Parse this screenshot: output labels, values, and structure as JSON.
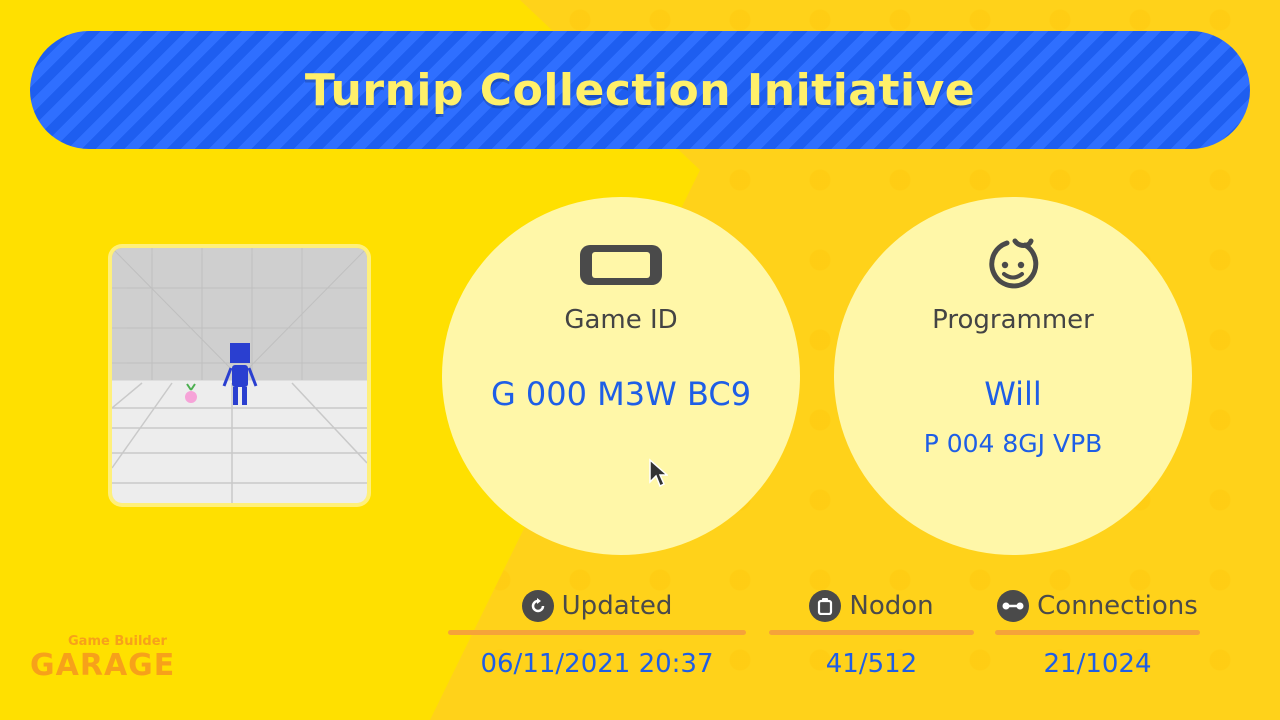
{
  "header": {
    "title": "Turnip Collection Initiative"
  },
  "game": {
    "label": "Game ID",
    "value": "G 000 M3W BC9"
  },
  "programmer": {
    "label": "Programmer",
    "name": "Will",
    "id": "P 004 8GJ VPB"
  },
  "stats": {
    "updated": {
      "label": "Updated",
      "value": "06/11/2021 20:37"
    },
    "nodon": {
      "label": "Nodon",
      "value": "41/512"
    },
    "connections": {
      "label": "Connections",
      "value": "21/1024"
    }
  },
  "logo": {
    "line1": "Game Builder",
    "line2": "GARAGE"
  },
  "colors": {
    "accent_blue": "#1E5EE6",
    "title_yellow": "#FFF06A",
    "bar_orange": "#F5A33A"
  }
}
